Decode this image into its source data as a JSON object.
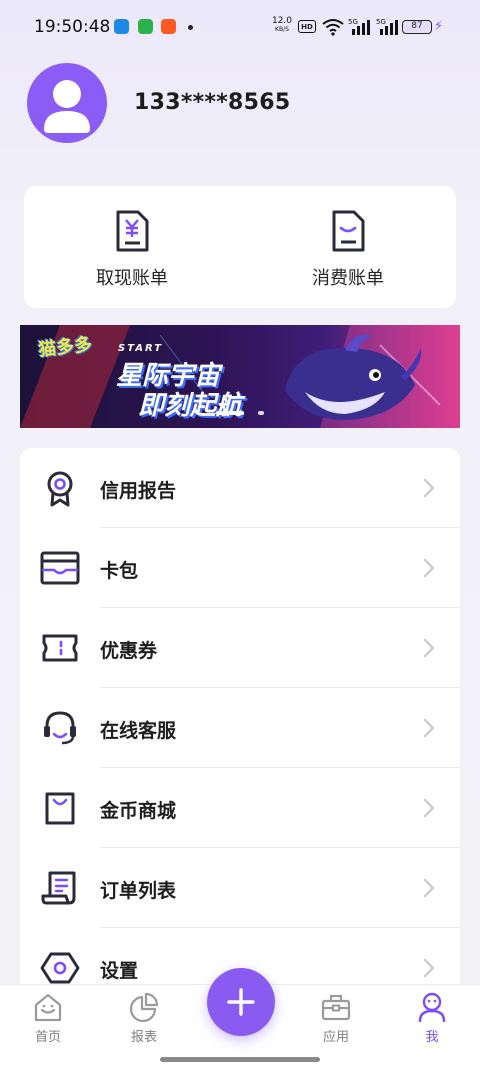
{
  "status_bar": {
    "time": "19:50:48",
    "net_speed_value": "12.0",
    "net_speed_unit": "KB/S",
    "hd_badge": "HD",
    "signal1_label": "5G",
    "signal2_label": "5G",
    "battery": "87",
    "icons": [
      "app-blue-icon",
      "phone-green-icon",
      "taobao-icon",
      "dot-icon",
      "wifi-icon",
      "signal-icon",
      "signal-icon",
      "battery-icon",
      "charging-icon"
    ]
  },
  "profile": {
    "phone": "133****8565",
    "avatar_icon": "user-avatar-icon"
  },
  "bills": [
    {
      "label": "取现账单",
      "icon": "yuan-receipt-icon"
    },
    {
      "label": "消费账单",
      "icon": "document-icon"
    }
  ],
  "banner": {
    "logo": "猫多多",
    "start": "START",
    "title_line1": "星际宇宙",
    "title_line2": "即刻起航",
    "slide_count": 2,
    "active_slide": 1
  },
  "menu": [
    {
      "label": "信用报告",
      "icon": "award-medal-icon"
    },
    {
      "label": "卡包",
      "icon": "card-wallet-icon"
    },
    {
      "label": "优惠券",
      "icon": "ticket-coupon-icon"
    },
    {
      "label": "在线客服",
      "icon": "headset-icon"
    },
    {
      "label": "金币商城",
      "icon": "shopping-bag-icon"
    },
    {
      "label": "订单列表",
      "icon": "order-list-icon"
    },
    {
      "label": "设置",
      "icon": "settings-hexagon-icon"
    }
  ],
  "bottom_nav": {
    "items": [
      {
        "label": "首页",
        "icon": "home-icon",
        "active": false
      },
      {
        "label": "报表",
        "icon": "pie-chart-icon",
        "active": false
      },
      {
        "label": "应用",
        "icon": "toolbox-icon",
        "active": false
      },
      {
        "label": "我",
        "icon": "profile-icon",
        "active": true
      }
    ],
    "fab_icon": "plus-icon"
  },
  "colors": {
    "accent": "#7C4DFF",
    "avatar_bg": "#8B5CF6",
    "icon_dark": "#2A2A3A",
    "chevron": "#C8C8C8"
  }
}
